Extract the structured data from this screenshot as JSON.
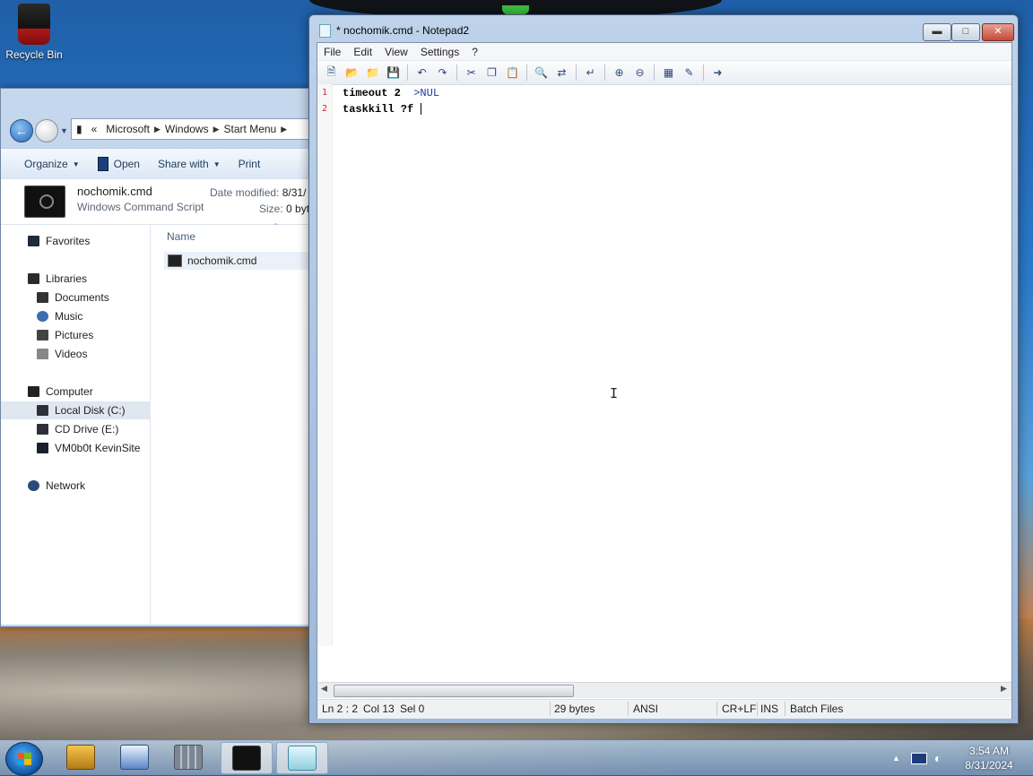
{
  "desktop": {
    "recycle_bin_label": "Recycle Bin"
  },
  "explorer": {
    "breadcrumb": [
      "«",
      "Microsoft",
      "Windows",
      "Start Menu"
    ],
    "toolbar": {
      "organize": "Organize",
      "open": "Open",
      "share_with": "Share with",
      "print": "Print"
    },
    "details": {
      "file_name": "nochomik.cmd",
      "file_type": "Windows Command Script",
      "date_modified_label": "Date modified:",
      "date_modified_value": "8/31/",
      "size_label": "Size:",
      "size_value": "0 byt"
    },
    "nav": {
      "favorites": "Favorites",
      "libraries": "Libraries",
      "documents": "Documents",
      "music": "Music",
      "pictures": "Pictures",
      "videos": "Videos",
      "computer": "Computer",
      "local_disk": "Local Disk (C:)",
      "cd_drive": "CD Drive (E:)",
      "vm_share": "VM0b0t KevinSite",
      "network": "Network"
    },
    "column_name": "Name",
    "files": [
      "nochomik.cmd"
    ]
  },
  "notepad": {
    "title": "* nochomik.cmd - Notepad2",
    "menu": [
      "File",
      "Edit",
      "View",
      "Settings",
      "?"
    ],
    "lines": [
      {
        "num": "1",
        "cmd": "timeout",
        "args": " 2  ",
        "redir": ">NUL"
      },
      {
        "num": "2",
        "cmd": "taskkill",
        "args": " ?f ",
        "redir": ""
      }
    ],
    "status": {
      "ln": "Ln 2 : 2",
      "col": "Col 13",
      "sel": "Sel 0",
      "bytes": "29 bytes",
      "encoding": "ANSI",
      "eol": "CR+LF",
      "ovr": "INS",
      "lexer": "Batch Files"
    }
  },
  "taskbar": {
    "time": "3:54 AM",
    "date": "8/31/2024"
  }
}
